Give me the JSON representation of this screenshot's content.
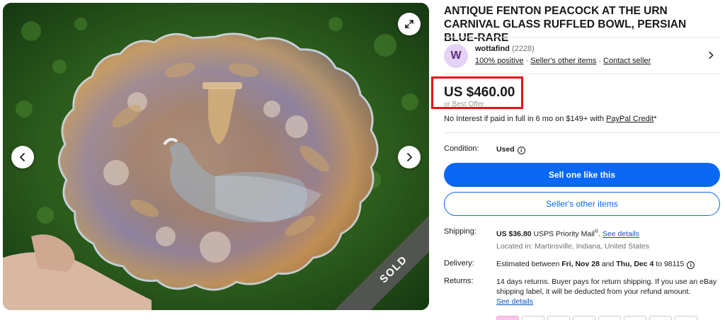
{
  "gallery": {
    "sold_ribbon": "SOLD",
    "prev_icon": "chevron-left-icon",
    "next_icon": "chevron-right-icon",
    "expand_icon": "expand-icon"
  },
  "listing": {
    "title": "ANTIQUE FENTON PEACOCK AT THE URN CARNIVAL GLASS RUFFLED BOWL, PERSIAN BLUE-RARE"
  },
  "seller": {
    "avatar_letter": "W",
    "name": "wottafind",
    "feedback_count": "(2228)",
    "positive": "100% positive",
    "other_items": "Seller's other items",
    "contact": "Contact seller"
  },
  "price": {
    "amount": "US $460.00",
    "best_offer": "or Best Offer",
    "financing_prefix": "No Interest if paid in full in 6 mo on $149+ with ",
    "financing_link": "PayPal Credit",
    "financing_suffix": "*",
    "highlight_color": "#e8101a"
  },
  "condition": {
    "label": "Condition:",
    "value": "Used"
  },
  "actions": {
    "primary": "Sell one like this",
    "secondary": "Seller's other items",
    "primary_color": "#0968f6"
  },
  "shipping": {
    "label": "Shipping:",
    "cost": "US $36.80",
    "service": " USPS Priority Mail",
    "reg": "®",
    "dot": ". ",
    "details_link": "See details",
    "location": "Located in: Martinsville, Indiana, United States"
  },
  "delivery": {
    "label": "Delivery:",
    "prefix": "Estimated between ",
    "start": "Fri, Nov 28",
    "and": " and ",
    "end": "Thu, Dec 4",
    "suffix": " to 98115"
  },
  "returns": {
    "label": "Returns:",
    "text": "14 days returns. Buyer pays for return shipping. If you use an eBay shipping label, it will be deducted from your refund amount.",
    "details_link": "See details"
  }
}
